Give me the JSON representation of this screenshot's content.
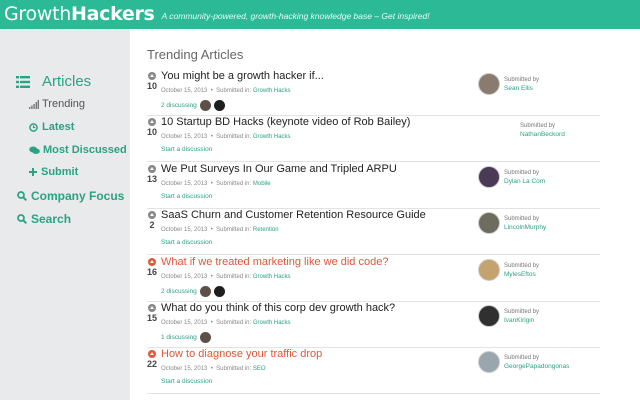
{
  "header": {
    "logo_regular": "Growth",
    "logo_bold": "Hackers",
    "tagline": "A community-powered, growth-hacking knowledge base – Get inspired!",
    "bg_color": "#2bb996"
  },
  "sidebar": {
    "articles": "Articles",
    "trending": "Trending",
    "latest": "Latest",
    "most_discussed": "Most Discussed",
    "submit": "Submit",
    "company_focus": "Company Focus",
    "search": "Search"
  },
  "main": {
    "section_title": "Trending Articles",
    "articles": [
      {
        "votes": "10",
        "title": "You might be a growth hacker if...",
        "date": "October 15, 2013",
        "submitted_in_label": "Submitted in:",
        "category": "Growth Hacks",
        "discussion": "2 discussing",
        "submitted_by_label": "Submitted by",
        "author": "Sean Ellis",
        "title_color": "dark",
        "has_avatar": true
      },
      {
        "votes": "10",
        "title": "10 Startup BD Hacks (keynote video of Rob Bailey)",
        "date": "October 15, 2013",
        "submitted_in_label": "Submitted in:",
        "category": "Growth Hacks",
        "discussion": "Start a discussion",
        "submitted_by_label": "Submitted by",
        "author": "NathanBeckord",
        "title_color": "dark",
        "has_avatar": false
      },
      {
        "votes": "13",
        "title": "We Put Surveys In Our Game and Tripled ARPU",
        "date": "October 15, 2013",
        "submitted_in_label": "Submitted in:",
        "category": "Mobile",
        "discussion": "Start a discussion",
        "submitted_by_label": "Submitted by",
        "author": "Dylan La Com",
        "title_color": "dark",
        "has_avatar": true
      },
      {
        "votes": "2",
        "title": "SaaS Churn and Customer Retention Resource Guide",
        "date": "October 15, 2013",
        "submitted_in_label": "Submitted in:",
        "category": "Retention",
        "discussion": "Start a discussion",
        "submitted_by_label": "Submitted by",
        "author": "LincolnMurphy",
        "title_color": "dark",
        "has_avatar": true
      },
      {
        "votes": "16",
        "title": "What if we treated marketing like we did code?",
        "date": "October 15, 2013",
        "submitted_in_label": "Submitted in:",
        "category": "Growth Hacks",
        "discussion": "2 discussing",
        "submitted_by_label": "Submitted by",
        "author": "MylesEftos",
        "title_color": "red",
        "has_avatar": true
      },
      {
        "votes": "15",
        "title": "What do you think of this corp dev growth hack?",
        "date": "October 15, 2013",
        "submitted_in_label": "Submitted in:",
        "category": "Growth Hacks",
        "discussion": "1 discussing",
        "submitted_by_label": "Submitted by",
        "author": "IvanKirigin",
        "title_color": "dark",
        "has_avatar": true
      },
      {
        "votes": "22",
        "title": "How to diagnose your traffic drop",
        "date": "October 15, 2013",
        "submitted_in_label": "Submitted in:",
        "category": "SEO",
        "discussion": "Start a discussion",
        "submitted_by_label": "Submitted by",
        "author": "GeorgePapadongonas",
        "title_color": "red",
        "has_avatar": true
      }
    ]
  },
  "colors": {
    "accent": "#2aa283",
    "highlight": "#e2563a",
    "sidebar_bg": "#e9eaeb"
  }
}
